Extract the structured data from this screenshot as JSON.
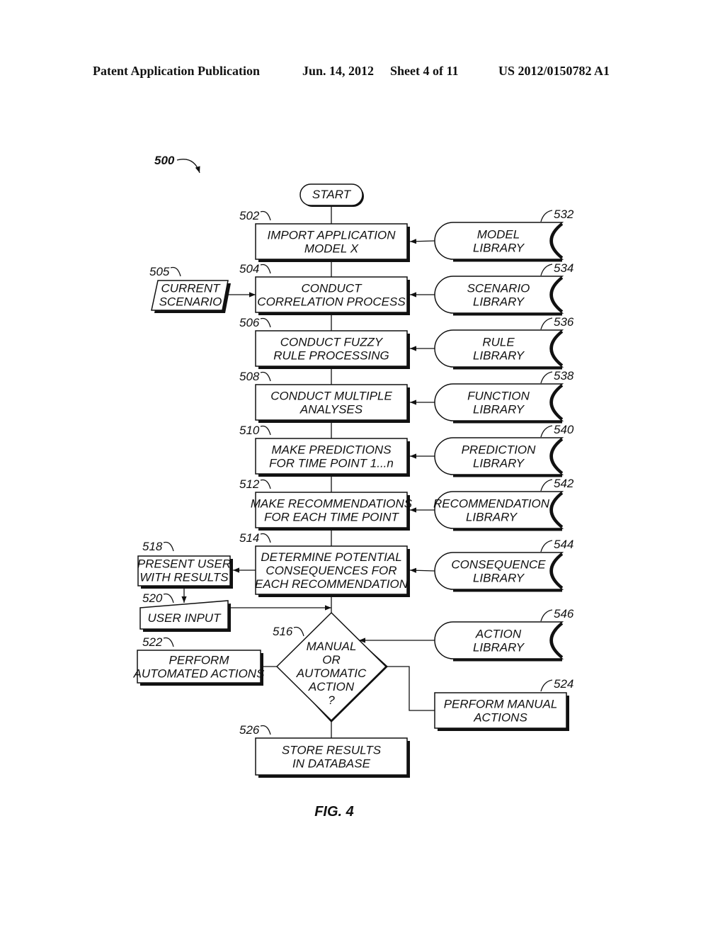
{
  "header": {
    "publication": "Patent Application Publication",
    "date": "Jun. 14, 2012",
    "sheet": "Sheet 4 of 11",
    "number": "US 2012/0150782 A1"
  },
  "figure": {
    "ref": "500",
    "caption": "FIG. 4",
    "start": "START",
    "steps": [
      {
        "ref": "502",
        "lines": [
          "IMPORT APPLICATION",
          "MODEL X"
        ]
      },
      {
        "ref": "504",
        "lines": [
          "CONDUCT",
          "CORRELATION PROCESS"
        ]
      },
      {
        "ref": "506",
        "lines": [
          "CONDUCT FUZZY",
          "RULE PROCESSING"
        ]
      },
      {
        "ref": "508",
        "lines": [
          "CONDUCT MULTIPLE",
          "ANALYSES"
        ]
      },
      {
        "ref": "510",
        "lines": [
          "MAKE PREDICTIONS",
          "FOR TIME POINT 1...n"
        ]
      },
      {
        "ref": "512",
        "lines": [
          "MAKE RECOMMENDATIONS",
          "FOR EACH TIME POINT"
        ]
      },
      {
        "ref": "514",
        "lines": [
          "DETERMINE POTENTIAL",
          "CONSEQUENCES FOR",
          "EACH RECOMMENDATION"
        ]
      }
    ],
    "libraries": [
      {
        "ref": "532",
        "lines": [
          "MODEL",
          "LIBRARY"
        ]
      },
      {
        "ref": "534",
        "lines": [
          "SCENARIO",
          "LIBRARY"
        ]
      },
      {
        "ref": "536",
        "lines": [
          "RULE",
          "LIBRARY"
        ]
      },
      {
        "ref": "538",
        "lines": [
          "FUNCTION",
          "LIBRARY"
        ]
      },
      {
        "ref": "540",
        "lines": [
          "PREDICTION",
          "LIBRARY"
        ]
      },
      {
        "ref": "542",
        "lines": [
          "RECOMMENDATION",
          "LIBRARY"
        ]
      },
      {
        "ref": "544",
        "lines": [
          "CONSEQUENCE",
          "LIBRARY"
        ]
      },
      {
        "ref": "546",
        "lines": [
          "ACTION",
          "LIBRARY"
        ]
      }
    ],
    "current_scenario": {
      "ref": "505",
      "lines": [
        "CURRENT",
        "SCENARIO"
      ]
    },
    "present_user": {
      "ref": "518",
      "lines": [
        "PRESENT USER",
        "WITH RESULTS"
      ]
    },
    "user_input": {
      "ref": "520",
      "lines": [
        "USER INPUT"
      ]
    },
    "decision": {
      "ref": "516",
      "lines": [
        "MANUAL",
        "OR",
        "AUTOMATIC",
        "ACTION",
        "?"
      ]
    },
    "automated": {
      "ref": "522",
      "lines": [
        "PERFORM",
        "AUTOMATED ACTIONS"
      ]
    },
    "manual": {
      "ref": "524",
      "lines": [
        "PERFORM MANUAL",
        "ACTIONS"
      ]
    },
    "store": {
      "ref": "526",
      "lines": [
        "STORE RESULTS",
        "IN DATABASE"
      ]
    }
  }
}
